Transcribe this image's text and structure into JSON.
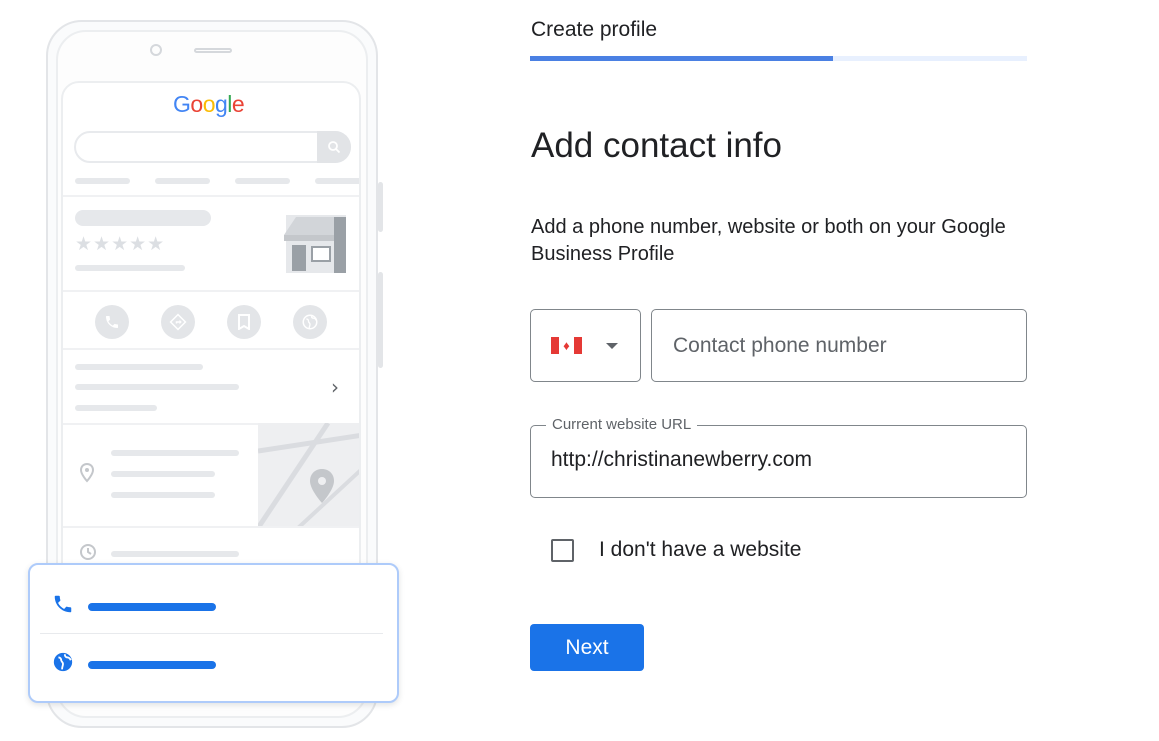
{
  "illustration": {
    "logo_letters": [
      "G",
      "o",
      "o",
      "g",
      "l",
      "e"
    ],
    "stars": "★★★★★",
    "chevron": "›",
    "icons": [
      "search-icon",
      "store-icon",
      "phone-icon",
      "directions-icon",
      "bookmark-icon",
      "globe-icon",
      "location-pin-icon",
      "clock-icon"
    ]
  },
  "header": {
    "step_title": "Create profile",
    "progress": 0.61
  },
  "form": {
    "heading": "Add contact info",
    "subtext": "Add a phone number, website or both on your Google Business Profile",
    "country_flag": "canada-flag-icon",
    "phone_placeholder": "Contact phone number",
    "phone_value": "",
    "website_label": "Current website URL",
    "website_value": "http://christinanewberry.com",
    "no_website_label": "I don't have a website",
    "no_website_checked": false,
    "next_label": "Next"
  },
  "colors": {
    "primary": "#1a73e8",
    "progress_fill": "#4a80e3",
    "progress_track": "#e8f0fe"
  }
}
